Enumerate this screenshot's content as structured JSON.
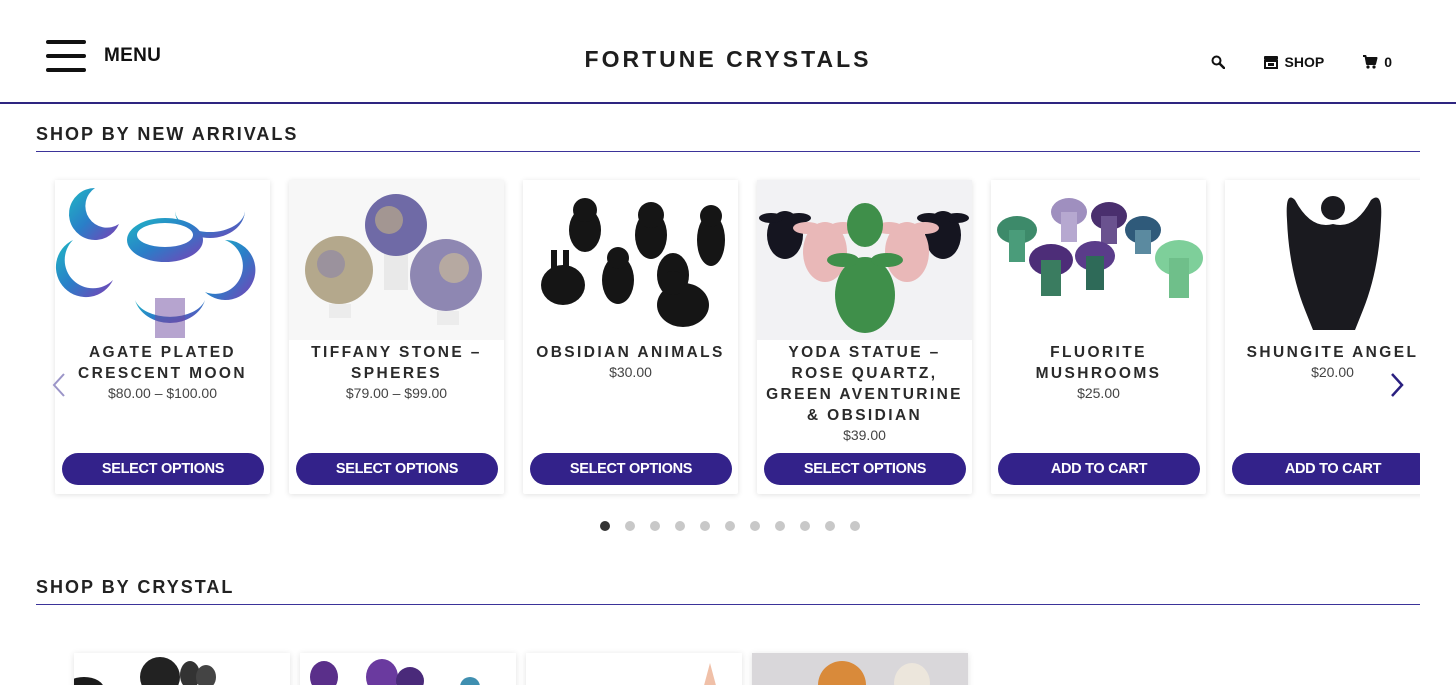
{
  "header": {
    "menu_label": "MENU",
    "brand": "FORTUNE CRYSTALS",
    "shop_label": "SHOP",
    "cart_count": "0"
  },
  "sections": {
    "new_arrivals_title": "SHOP BY NEW ARRIVALS",
    "crystal_title": "SHOP BY CRYSTAL"
  },
  "products": [
    {
      "title": "AGATE PLATED CRESCENT MOON",
      "price": "$80.00 – $100.00",
      "button": "SELECT OPTIONS"
    },
    {
      "title": "TIFFANY STONE – SPHERES",
      "price": "$79.00 – $99.00",
      "button": "SELECT OPTIONS"
    },
    {
      "title": "OBSIDIAN ANIMALS",
      "price": "$30.00",
      "button": "SELECT OPTIONS"
    },
    {
      "title": "YODA STATUE – ROSE QUARTZ, GREEN AVENTURINE & OBSIDIAN",
      "price": "$39.00",
      "button": "SELECT OPTIONS"
    },
    {
      "title": "FLUORITE MUSHROOMS",
      "price": "$25.00",
      "button": "ADD TO CART"
    },
    {
      "title": "SHUNGITE ANGEL",
      "price": "$20.00",
      "button": "ADD TO CART"
    }
  ],
  "pagination": {
    "total": 11,
    "active_index": 0
  },
  "colors": {
    "accent": "#33228a",
    "rule": "#3b3399"
  }
}
